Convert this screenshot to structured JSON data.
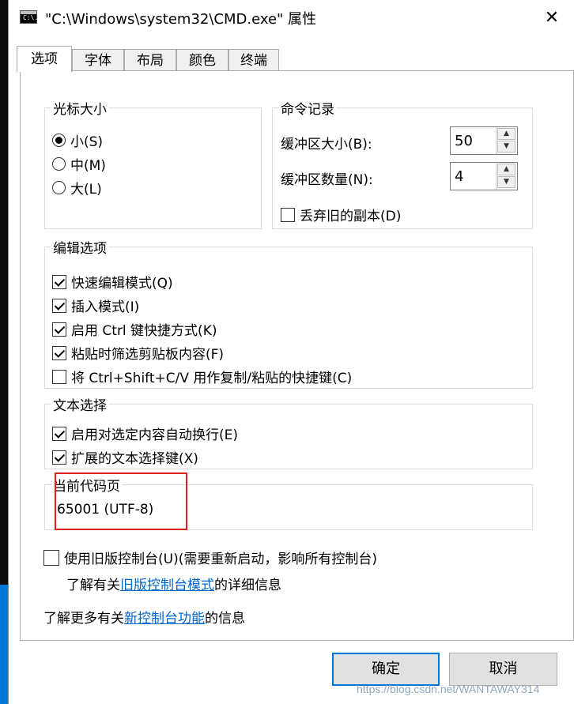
{
  "window": {
    "title": "\"C:\\Windows\\system32\\CMD.exe\" 属性",
    "icon_text": "C:\\.",
    "close_glyph": "✕"
  },
  "tabs": [
    {
      "label": "选项",
      "active": true
    },
    {
      "label": "字体",
      "active": false
    },
    {
      "label": "布局",
      "active": false
    },
    {
      "label": "颜色",
      "active": false
    },
    {
      "label": "终端",
      "active": false
    }
  ],
  "cursor_size": {
    "title": "光标大小",
    "options": [
      {
        "label": "小(S)",
        "selected": true
      },
      {
        "label": "中(M)",
        "selected": false
      },
      {
        "label": "大(L)",
        "selected": false
      }
    ]
  },
  "command_history": {
    "title": "命令记录",
    "buffer_size_label": "缓冲区大小(B):",
    "buffer_size_value": "50",
    "buffer_count_label": "缓冲区数量(N):",
    "buffer_count_value": "4",
    "discard_old_label": "丢弃旧的副本(D)",
    "discard_old_checked": false
  },
  "edit_options": {
    "title": "编辑选项",
    "items": [
      {
        "label": "快速编辑模式(Q)",
        "checked": true
      },
      {
        "label": "插入模式(I)",
        "checked": true
      },
      {
        "label": "启用 Ctrl 键快捷方式(K)",
        "checked": true
      },
      {
        "label": "粘贴时筛选剪贴板内容(F)",
        "checked": true
      },
      {
        "label": "将 Ctrl+Shift+C/V 用作复制/粘贴的快捷键(C)",
        "checked": false
      }
    ]
  },
  "text_selection": {
    "title": "文本选择",
    "items": [
      {
        "label": "启用对选定内容自动换行(E)",
        "checked": true
      },
      {
        "label": "扩展的文本选择键(X)",
        "checked": true
      }
    ]
  },
  "code_page": {
    "title": "当前代码页",
    "value": "65001 (UTF-8)"
  },
  "legacy": {
    "checkbox_label": "使用旧版控制台(U)(需要重新启动，影响所有控制台)",
    "checked": false,
    "info_prefix": "了解有关",
    "info_link": "旧版控制台模式",
    "info_suffix": "的详细信息"
  },
  "more_info": {
    "prefix": "了解更多有关",
    "link": "新控制台功能",
    "suffix": "的信息"
  },
  "buttons": {
    "ok": "确定",
    "cancel": "取消"
  },
  "watermark": "https://blog.csdn.net/WANTAWAY314",
  "colors": {
    "highlight_border": "#e02020",
    "link": "#0066cc",
    "default_button_border": "#0078d7",
    "desktop_blue": "#0078d7"
  }
}
